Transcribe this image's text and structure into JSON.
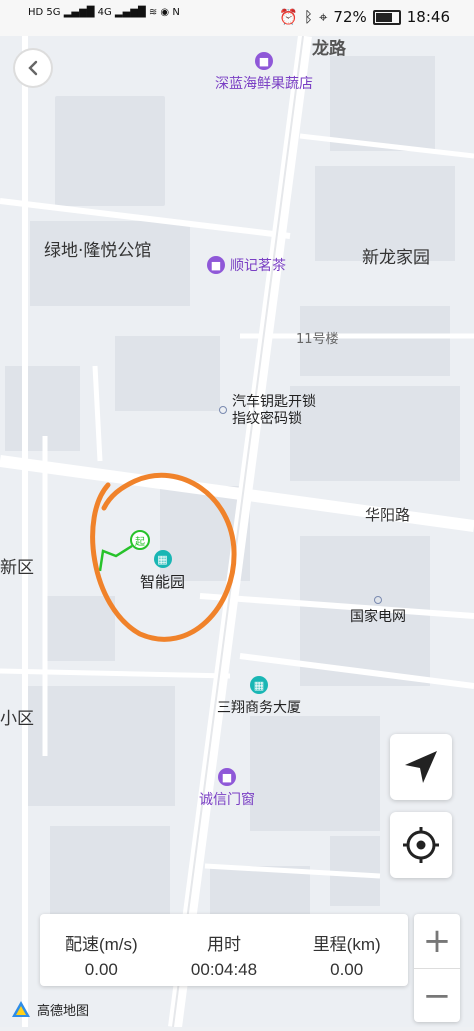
{
  "status_bar": {
    "battery": "72%",
    "time": "18:46"
  },
  "map": {
    "labels": {
      "road_long": "龙路",
      "residence_top_left": "绿地·隆悦公馆",
      "residence_right": "新龙家园",
      "building_no": "11号楼",
      "road_huayang": "华阳路",
      "district_left": "新区",
      "small_district": "小区"
    },
    "pois": {
      "seafood_store": "深蓝海鲜果蔬店",
      "tea_shop": "顺记茗茶",
      "locksmith_line1": "汽车钥匙开锁",
      "locksmith_line2": "指纹密码锁",
      "smart_park": "智能园",
      "state_grid": "国家电网",
      "sanxiang_building": "三翔商务大厦",
      "chengxin_window": "诚信门窗"
    },
    "start_marker": "起"
  },
  "stats": {
    "pace_label": "配速(m/s)",
    "pace_value": "0.00",
    "time_label": "用时",
    "time_value": "00:04:48",
    "distance_label": "里程(km)",
    "distance_value": "0.00"
  },
  "zoom": {
    "in": "+",
    "out": "−"
  },
  "brand": {
    "name": "高德地图"
  },
  "colors": {
    "annotation": "#f0822a",
    "track": "#27c22a",
    "poi_purple": "#8f58d8",
    "poi_teal": "#19b6b4"
  },
  "icons": [
    "back-icon",
    "navigate-arrow-icon",
    "locate-target-icon",
    "amap-logo-icon"
  ]
}
